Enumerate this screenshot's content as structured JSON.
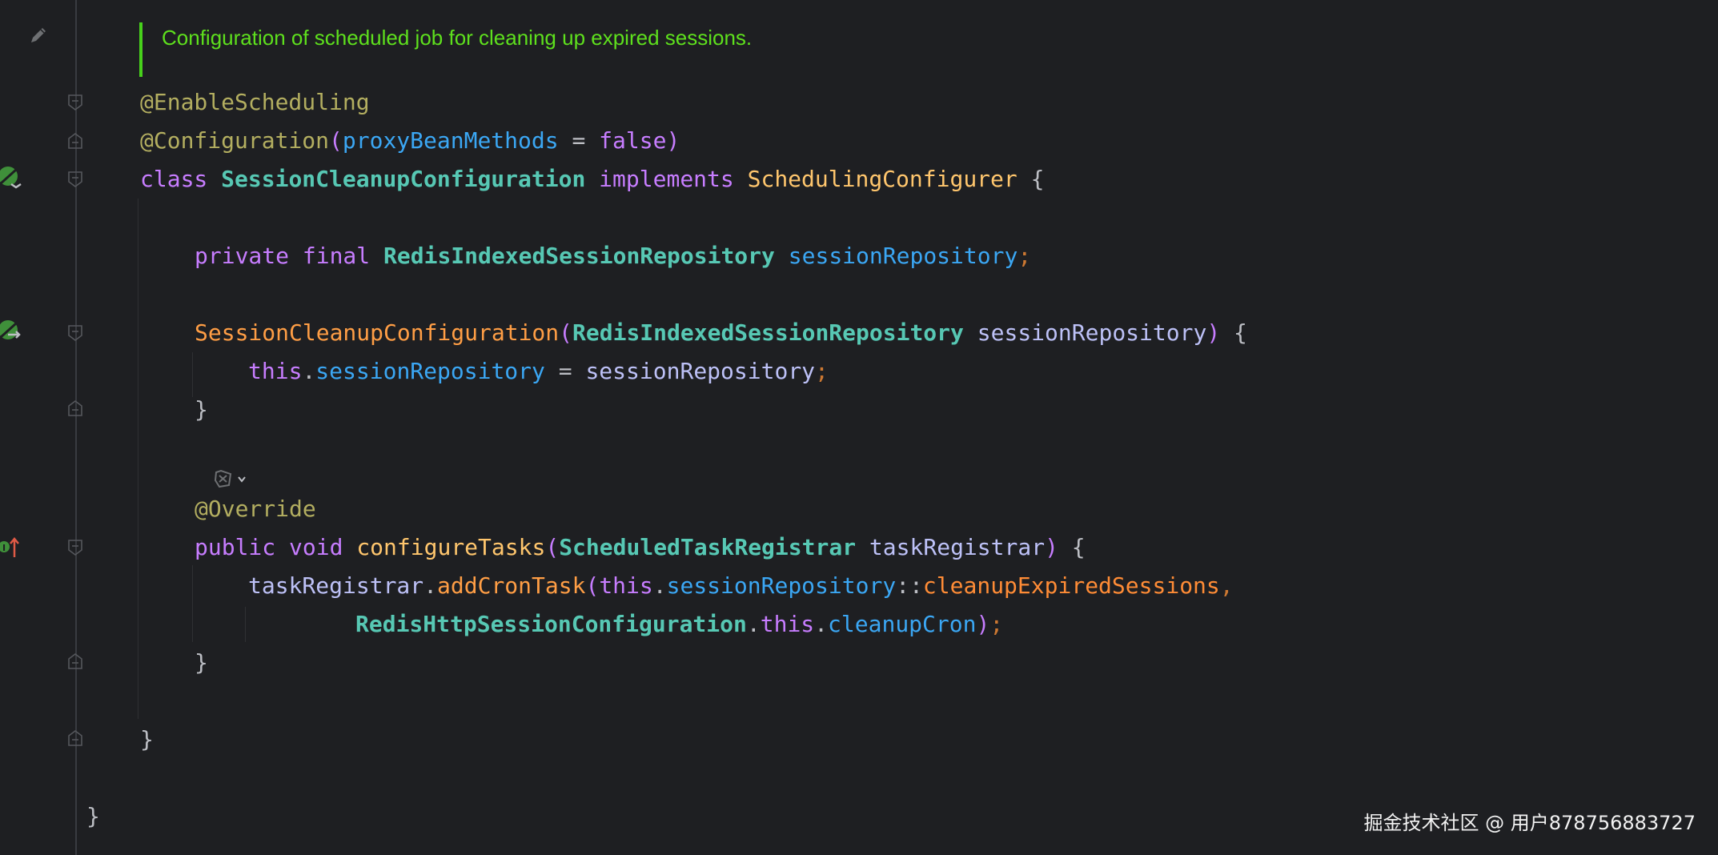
{
  "doc_comment": "Configuration of scheduled job for cleaning up expired sessions.",
  "lines": {
    "l1_annotation": "@EnableScheduling",
    "l2_annotation": "@Configuration",
    "l2_open": "(",
    "l2_param": "proxyBeanMethods",
    "l2_eq": " = ",
    "l2_value": "false",
    "l2_close": ")",
    "l3_class": "class ",
    "l3_name": "SessionCleanupConfiguration",
    "l3_implements": " implements ",
    "l3_iface": "SchedulingConfigurer",
    "l3_brace": " {",
    "l4_private": "private ",
    "l4_final": "final ",
    "l4_type": "RedisIndexedSessionRepository",
    "l4_field": " sessionRepository",
    "l4_semi": ";",
    "l5_ctor": "SessionCleanupConfiguration",
    "l5_open": "(",
    "l5_type": "RedisIndexedSessionRepository",
    "l5_param": " sessionRepository",
    "l5_close": ")",
    "l5_brace": " {",
    "l6_this": "this",
    "l6_dot": ".",
    "l6_field": "sessionRepository",
    "l6_eq": " = ",
    "l6_param": "sessionRepository",
    "l6_semi": ";",
    "l7_close": "}",
    "l8_annotation": "@Override",
    "l9_public": "public ",
    "l9_void": "void ",
    "l9_method": "configureTasks",
    "l9_open": "(",
    "l9_type": "ScheduledTaskRegistrar",
    "l9_param": " taskRegistrar",
    "l9_close": ")",
    "l9_brace": " {",
    "l10_var": "taskRegistrar",
    "l10_dot": ".",
    "l10_call": "addCronTask",
    "l10_open": "(",
    "l10_this": "this",
    "l10_dot2": ".",
    "l10_field": "sessionRepository",
    "l10_ref": "::",
    "l10_method": "cleanupExpiredSessions",
    "l10_comma": ",",
    "l11_type": "RedisHttpSessionConfiguration",
    "l11_dot": ".",
    "l11_this": "this",
    "l11_dot2": ".",
    "l11_field": "cleanupCron",
    "l11_close": ")",
    "l11_semi": ";",
    "l12_close": "}",
    "l13_close": "}",
    "l14_close": "}"
  },
  "icons": {
    "doc_edit": "pencil-icon",
    "bean_class": "spring-bean-icon",
    "bean_ctor": "spring-injection-icon",
    "override": "override-method-icon",
    "inlay": "ai-hints-icon",
    "fold": "fold-marker-icon"
  },
  "colors": {
    "background": "#1e1f22",
    "comment": "#5ee01d",
    "keyword": "#c77dff",
    "annotation": "#b3ae60",
    "type": "#57c8b4",
    "interface": "#ffc66d",
    "field": "#3ba7f4",
    "parameter": "#bdc1f7",
    "method": "#ffc66d",
    "constructor": "#ff9e45"
  },
  "watermark": "掘金技术社区 @ 用户878756883727"
}
